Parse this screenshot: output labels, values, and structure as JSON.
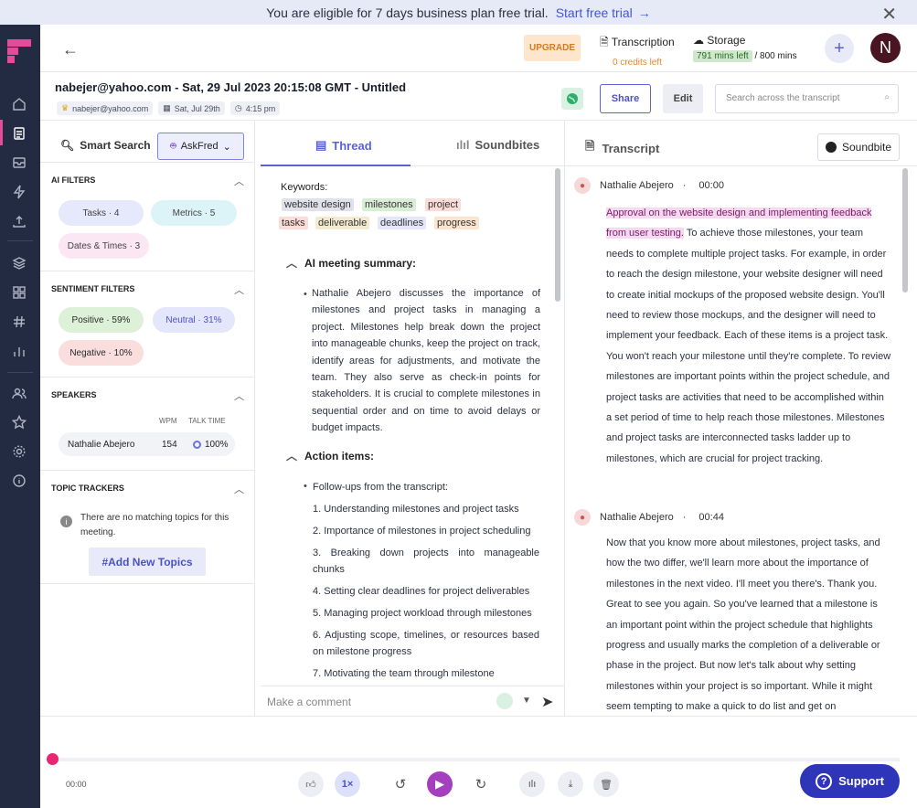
{
  "banner": {
    "text": "You are eligible for 7 days business plan free trial.",
    "link": "Start free trial"
  },
  "topbar": {
    "upgrade": "UPGRADE",
    "transcription_label": "Transcription",
    "credits": "0 credits left",
    "storage_label": "Storage",
    "mins_left": "791 mins left",
    "mins_total": "/ 800 mins",
    "avatar_letter": "N"
  },
  "meeting": {
    "title": "nabejer@yahoo.com - Sat, 29 Jul 2023 20:15:08 GMT - Untitled",
    "email": "nabejer@yahoo.com",
    "date": "Sat, Jul 29th",
    "time": "4:15 pm",
    "share": "Share",
    "edit": "Edit",
    "search_placeholder": "Search across the transcript"
  },
  "left": {
    "smart_search": "Smart Search",
    "askfred": "AskFred",
    "ai_filters_title": "AI FILTERS",
    "ai_filters": [
      "Tasks · 4",
      "Metrics · 5",
      "Dates & Times · 3"
    ],
    "sentiment_title": "SENTIMENT FILTERS",
    "sentiment": [
      "Positive · 59%",
      "Neutral · 31%",
      "Negative · 10%"
    ],
    "speakers_title": "SPEAKERS",
    "wpm_label": "WPM",
    "talk_label": "TALK TIME",
    "speaker_name": "Nathalie Abejero",
    "speaker_wpm": "154",
    "speaker_talk": "100%",
    "topic_title": "TOPIC TRACKERS",
    "topic_empty": "There are no matching topics for this meeting.",
    "add_topics": "#Add New Topics"
  },
  "middle": {
    "tab_thread": "Thread",
    "tab_soundbites": "Soundbites",
    "keywords_label": "Keywords:",
    "keywords": [
      "website design",
      "milestones",
      "project",
      "tasks",
      "deliverable",
      "deadlines",
      "progress"
    ],
    "summary_title": "AI meeting summary:",
    "summary": "Nathalie Abejero discusses the importance of milestones and project tasks in managing a project. Milestones help break down the project into manageable chunks, keep the project on track, identify areas for adjustments, and motivate the team. They also serve as check-in points for stakeholders. It is crucial to complete milestones in sequential order and on time to avoid delays or budget impacts.",
    "action_title": "Action items:",
    "action_intro": "Follow-ups from the transcript:",
    "actions": [
      "1. Understanding milestones and project tasks",
      "2. Importance of milestones in project scheduling",
      "3. Breaking down projects into manageable chunks",
      "4. Setting clear deadlines for project deliverables",
      "5. Managing project workload through milestones",
      "6. Adjusting scope, timelines, or resources based on milestone progress",
      "7. Motivating the team through milestone"
    ],
    "comment_placeholder": "Make a comment"
  },
  "right": {
    "title": "Transcript",
    "soundbite": "Soundbite",
    "blocks": [
      {
        "speaker": "Nathalie Abejero",
        "time": "00:00",
        "highlight": "Approval on the website design and implementing feedback from user testing.",
        "text": " To achieve those milestones, your team needs to complete multiple project tasks. For example, in order to reach the design milestone, your website designer will need to create initial mockups of the proposed website design. You'll need to review those mockups, and the designer will need to implement your feedback. Each of these items is a project task. You won't reach your milestone until they're complete. To review milestones are important points within the project schedule, and project tasks are activities that need to be accomplished within a set period of time to help reach those milestones. Milestones and project tasks are interconnected tasks ladder up to milestones, which are crucial for project tracking."
      },
      {
        "speaker": "Nathalie Abejero",
        "time": "00:44",
        "text": "Now that you know more about milestones, project tasks, and how the two differ, we'll learn more about the importance of milestones in the next video. I'll meet you there's. Thank you. Great to see you again. So you've learned that a milestone is an important point within the project schedule that highlights progress and usually marks the completion of a deliverable or phase in the project. But now let's talk about why setting milestones within your project is so important. While it might seem tempting to make a quick to do list and get on"
      }
    ]
  },
  "player": {
    "time": "00:00",
    "speed": "1×",
    "support": "Support",
    "progress": 0
  },
  "colors": {
    "accent": "#5b63d6",
    "rail": "#232b42",
    "play": "#a43fbd",
    "support": "#2f35b8"
  }
}
